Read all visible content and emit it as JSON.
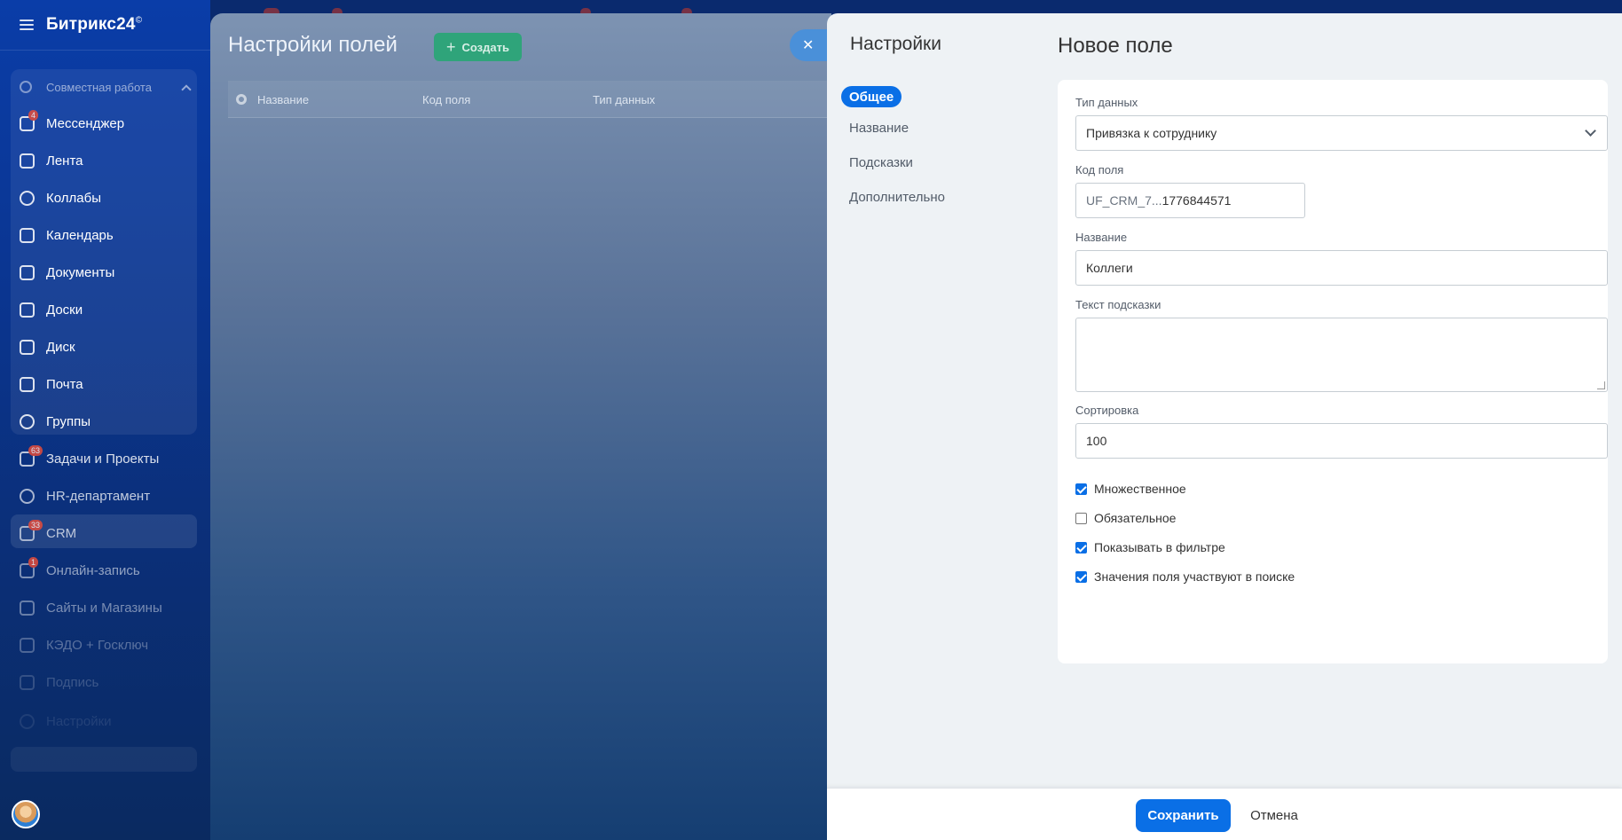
{
  "sidebar": {
    "logo": "Битрикс24",
    "logo_mark": "©",
    "group_title": "Совместная работа",
    "items": [
      {
        "label": "Мессенджер",
        "badge": "4"
      },
      {
        "label": "Лента",
        "badge": ""
      },
      {
        "label": "Коллабы",
        "badge": ""
      },
      {
        "label": "Календарь",
        "badge": ""
      },
      {
        "label": "Документы",
        "badge": ""
      },
      {
        "label": "Доски",
        "badge": ""
      },
      {
        "label": "Диск",
        "badge": ""
      },
      {
        "label": "Почта",
        "badge": ""
      },
      {
        "label": "Группы",
        "badge": ""
      },
      {
        "label": "Задачи и Проекты",
        "badge": "63"
      },
      {
        "label": "HR-департамент",
        "badge": ""
      },
      {
        "label": "CRM",
        "badge": "33"
      },
      {
        "label": "Онлайн-запись",
        "badge": "1"
      },
      {
        "label": "Сайты и Магазины",
        "badge": ""
      },
      {
        "label": "КЭДО + Госключ",
        "badge": ""
      },
      {
        "label": "Подпись",
        "badge": ""
      },
      {
        "label": "Настройки",
        "badge": ""
      }
    ]
  },
  "middle": {
    "title": "Настройки полей",
    "create_label": "Создать",
    "columns": [
      "Название",
      "Код поля",
      "Тип данных"
    ]
  },
  "panel": {
    "side_title": "Настройки",
    "nav": [
      "Общее",
      "Название",
      "Подсказки",
      "Дополнительно"
    ],
    "form_title": "Новое поле",
    "fields": {
      "data_type_label": "Тип данных",
      "data_type_value": "Привязка к сотруднику",
      "code_label": "Код поля",
      "code_prefix": "UF_CRM_7...",
      "code_value": "1776844571",
      "name_label": "Название",
      "name_value": "Коллеги",
      "hint_label": "Текст подсказки",
      "hint_value": "",
      "sort_label": "Сортировка",
      "sort_value": "100"
    },
    "checkboxes": [
      {
        "label": "Множественное",
        "checked": true
      },
      {
        "label": "Обязательное",
        "checked": false
      },
      {
        "label": "Показывать в фильтре",
        "checked": true
      },
      {
        "label": "Значения поля участвуют в поиске",
        "checked": true
      }
    ]
  },
  "footer": {
    "save_label": "Сохранить",
    "cancel_label": "Отмена"
  },
  "colors": {
    "accent": "#0a6fe6",
    "create_green": "#2fa47a",
    "badge_red": "#e44c3a"
  }
}
